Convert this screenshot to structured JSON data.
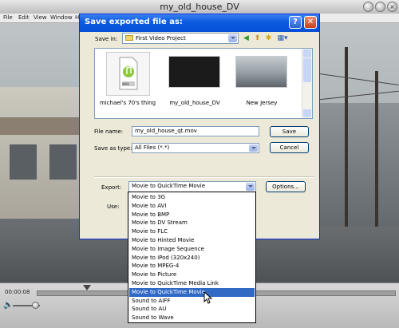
{
  "player": {
    "title": "my_old_house_DV",
    "menus": [
      "File",
      "Edit",
      "View",
      "Window",
      "H"
    ],
    "timecode": "00:00:08",
    "colors": {
      "titlebar": "#d0d0d0",
      "controls": "#c8c8c8"
    }
  },
  "dialog": {
    "title": "Save exported file as:",
    "help_symbol": "?",
    "close_symbol": "✕",
    "save_in_label": "Save in:",
    "save_in_value": "First Video Project",
    "toolbar_icons": [
      "back-icon",
      "up-folder-icon",
      "new-folder-icon",
      "views-menu-icon"
    ],
    "files": [
      {
        "name": "michael's 70's thing",
        "type": "audio",
        "badge": "WAV"
      },
      {
        "name": "my_old_house_DV",
        "type": "video"
      },
      {
        "name": "New Jersey",
        "type": "video"
      }
    ],
    "file_name_label": "File name:",
    "file_name_value": "my_old_house_qt.mov",
    "save_as_type_label": "Save as type:",
    "save_as_type_value": "All Files (*.*)",
    "save_label": "Save",
    "cancel_label": "Cancel",
    "export_label": "Export:",
    "export_value": "Movie to QuickTime Movie",
    "options_label": "Options...",
    "use_label": "Use:",
    "colors": {
      "title_bar": "#0a5ae0",
      "selection": "#316ac5",
      "face": "#ece9d8"
    }
  },
  "export_options": [
    "Movie to 3G",
    "Movie to AVI",
    "Movie to BMP",
    "Movie to DV Stream",
    "Movie to FLC",
    "Movie to Hinted Movie",
    "Movie to Image Sequence",
    "Movie to iPod (320x240)",
    "Movie to MPEG-4",
    "Movie to Picture",
    "Movie to QuickTime Media Link",
    "Movie to QuickTime Movie",
    "Sound to AIFF",
    "Sound to AU",
    "Sound to Wave"
  ],
  "selected_export_option": "Movie to QuickTime Movie"
}
